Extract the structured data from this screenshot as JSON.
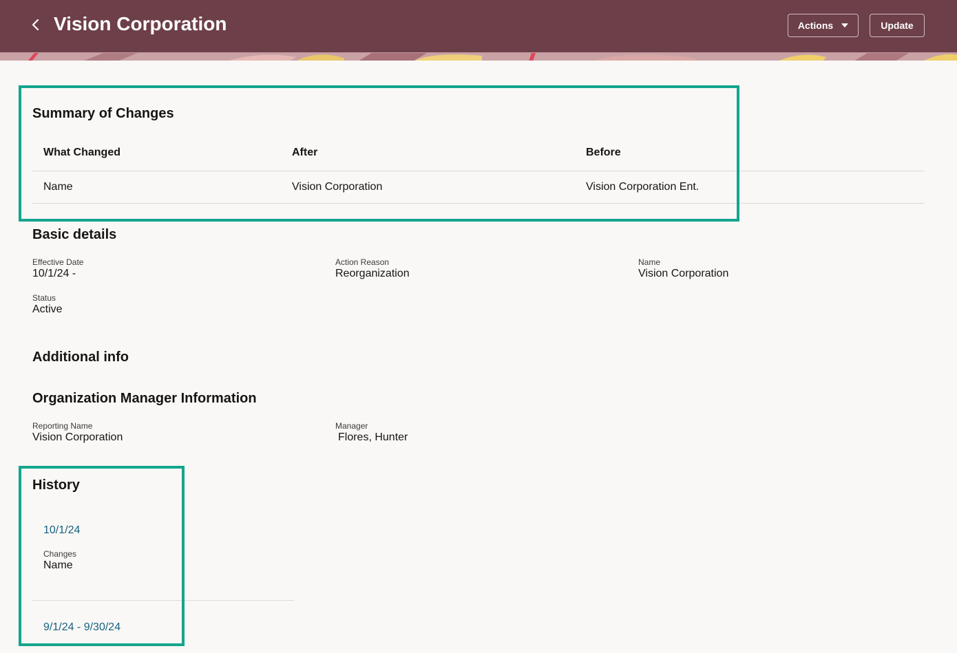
{
  "header": {
    "title": "Vision Corporation",
    "actions_label": "Actions",
    "update_label": "Update",
    "background_color": "#6d3f49"
  },
  "summary": {
    "title": "Summary of Changes",
    "columns": [
      "What Changed",
      "After",
      "Before"
    ],
    "rows": [
      [
        "Name",
        "Vision Corporation",
        "Vision Corporation Ent."
      ]
    ]
  },
  "basic_details": {
    "title": "Basic details",
    "effective_date_label": "Effective Date",
    "effective_date_value": "10/1/24 -",
    "action_reason_label": "Action Reason",
    "action_reason_value": "Reorganization",
    "name_label": "Name",
    "name_value": "Vision Corporation",
    "status_label": "Status",
    "status_value": "Active"
  },
  "additional_info": {
    "title": "Additional info"
  },
  "org_manager": {
    "title": "Organization Manager Information",
    "reporting_name_label": "Reporting Name",
    "reporting_name_value": "Vision Corporation",
    "manager_label": "Manager",
    "manager_value": "Flores, Hunter"
  },
  "history": {
    "title": "History",
    "entries": [
      {
        "date": "10/1/24",
        "changes_label": "Changes",
        "changes_value": "Name"
      },
      {
        "date": "9/1/24 - 9/30/24"
      }
    ]
  },
  "colors": {
    "link": "#17607e",
    "highlight": "#14a58e",
    "page_background": "#f9f8f6"
  }
}
